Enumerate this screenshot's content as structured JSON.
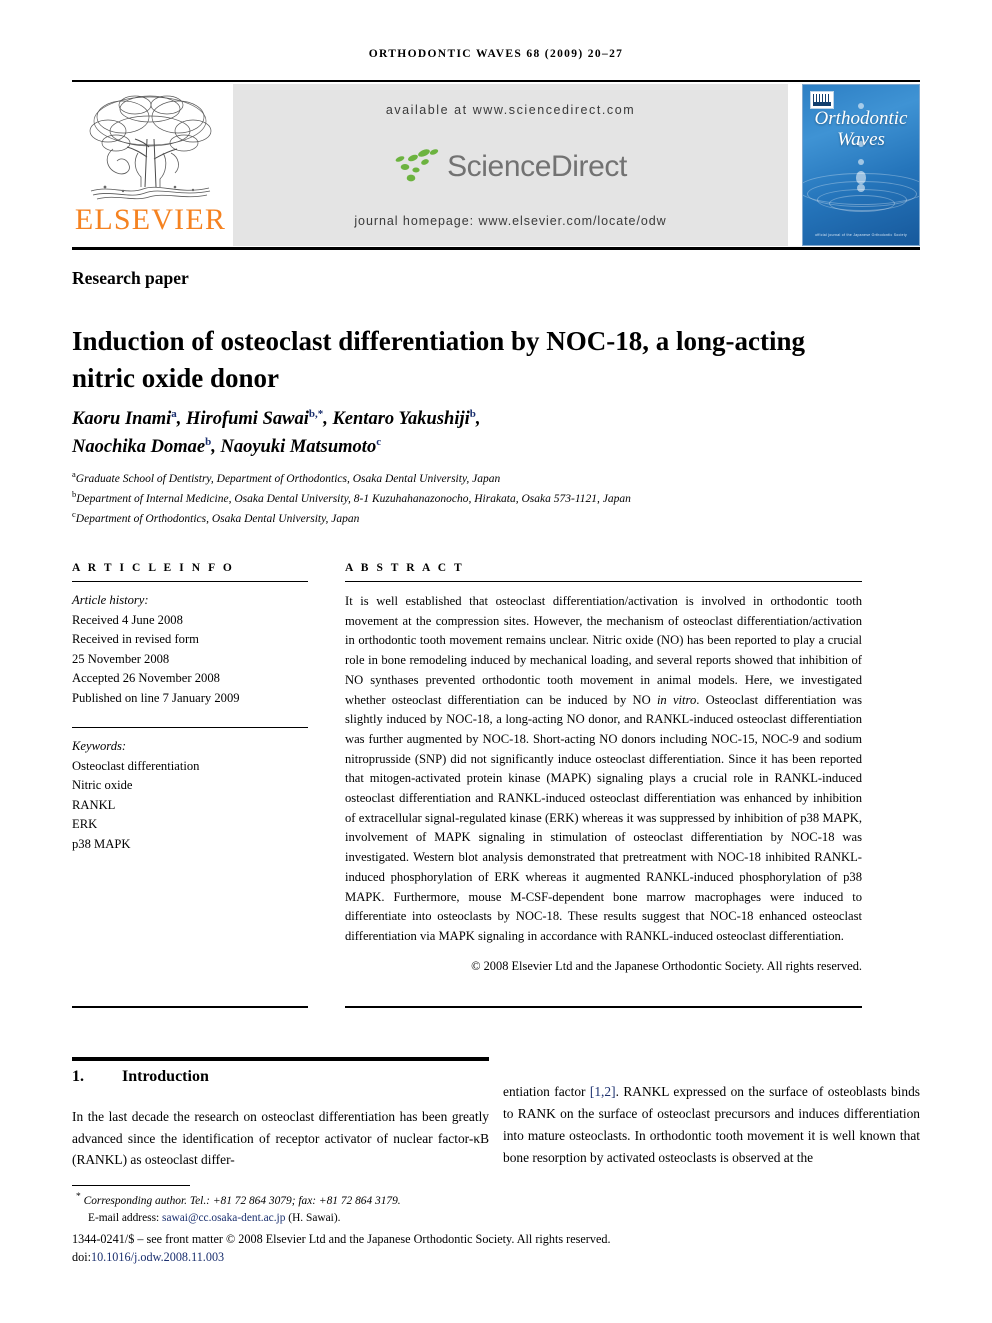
{
  "running_head": "ORTHODONTIC WAVES 68 (2009) 20–27",
  "masthead": {
    "publisher_wordmark": "ELSEVIER",
    "available_at": "available at www.sciencedirect.com",
    "sciencedirect_wordmark": "ScienceDirect",
    "journal_homepage": "journal homepage: www.elsevier.com/locate/odw",
    "cover": {
      "title_line1": "Orthodontic",
      "title_line2": "Waves",
      "footer": "official journal of the Japanese Orthodontic Society"
    },
    "colors": {
      "elsevier_orange": "#F58220",
      "sciencedirect_green": "#6CB33F",
      "sciencedirect_grey": "#727272",
      "band_grey": "#E4E4E4",
      "cover_blue": "#2D7FC4",
      "link_navy": "#1A2F6E"
    }
  },
  "article": {
    "section_type": "Research paper",
    "title": "Induction of osteoclast differentiation by NOC-18, a long-acting nitric oxide donor",
    "authors": [
      {
        "name": "Kaoru Inami",
        "marks": "a"
      },
      {
        "name": "Hirofumi Sawai",
        "marks": "b,*"
      },
      {
        "name": "Kentaro Yakushiji",
        "marks": "b"
      },
      {
        "name": "Naochika Domae",
        "marks": "b"
      },
      {
        "name": "Naoyuki Matsumoto",
        "marks": "c"
      }
    ],
    "affiliations": [
      {
        "mark": "a",
        "text": "Graduate School of Dentistry, Department of Orthodontics, Osaka Dental University, Japan"
      },
      {
        "mark": "b",
        "text": "Department of Internal Medicine, Osaka Dental University, 8-1 Kuzuhahanazonocho, Hirakata, Osaka 573-1121, Japan"
      },
      {
        "mark": "c",
        "text": "Department of Orthodontics, Osaka Dental University, Japan"
      }
    ]
  },
  "article_info": {
    "label": "A R T I C L E   I N F O",
    "history_heading": "Article history:",
    "history": [
      "Received 4 June 2008",
      "Received in revised form",
      "25 November 2008",
      "Accepted 26 November 2008",
      "Published on line 7 January 2009"
    ],
    "keywords_heading": "Keywords:",
    "keywords": [
      "Osteoclast differentiation",
      "Nitric oxide",
      "RANKL",
      "ERK",
      "p38 MAPK"
    ]
  },
  "abstract": {
    "label": "A B S T R A C T",
    "text_part1": "It is well established that osteoclast differentiation/activation is involved in orthodontic tooth movement at the compression sites. However, the mechanism of osteoclast differentiation/activation in orthodontic tooth movement remains unclear. Nitric oxide (NO) has been reported to play a crucial role in bone remodeling induced by mechanical loading, and several reports showed that inhibition of NO synthases prevented orthodontic tooth movement in animal models. Here, we investigated whether osteoclast differentiation can be induced by NO ",
    "italic1": "in vitro",
    "text_part2": ". Osteoclast differentiation was slightly induced by NOC-18, a long-acting NO donor, and RANKL-induced osteoclast differentiation was further augmented by NOC-18. Short-acting NO donors including NOC-15, NOC-9 and sodium nitroprusside (SNP) did not significantly induce osteoclast differentiation. Since it has been reported that mitogen-activated protein kinase (MAPK) signaling plays a crucial role in RANKL-induced osteoclast differentiation and RANKL-induced osteoclast differentiation was enhanced by inhibition of extracellular signal-regulated kinase (ERK) whereas it was suppressed by inhibition of p38 MAPK, involvement of MAPK signaling in stimulation of osteoclast differentiation by NOC-18 was investigated. Western blot analysis demonstrated that pretreatment with NOC-18 inhibited RANKL-induced phosphorylation of ERK whereas it augmented RANKL-induced phosphorylation of p38 MAPK. Furthermore, mouse M-CSF-dependent bone marrow macrophages were induced to differentiate into osteoclasts by NOC-18. These results suggest that NOC-18 enhanced osteoclast differentiation via MAPK signaling in accordance with RANKL-induced osteoclast differentiation.",
    "copyright": "© 2008 Elsevier Ltd and the Japanese Orthodontic Society. All rights reserved."
  },
  "body": {
    "section_number": "1.",
    "section_title": "Introduction",
    "left_paragraph": "In the last decade the research on osteoclast differentiation has been greatly advanced since the identification of receptor activator of nuclear factor-κB (RANKL) as osteoclast differ-",
    "right_paragraph_pre": "entiation factor ",
    "right_reference": "[1,2]",
    "right_paragraph_post": ". RANKL expressed on the surface of osteoblasts binds to RANK on the surface of osteoclast precursors and induces differentiation into mature osteoclasts. In orthodontic tooth movement it is well known that bone resorption by activated osteoclasts is observed at the"
  },
  "footer": {
    "corresponding_marker": "*",
    "corresponding": "Corresponding author. Tel.: +81 72 864 3079; fax: +81 72 864 3179.",
    "email_label": "E-mail address:",
    "email": "sawai@cc.osaka-dent.ac.jp",
    "email_owner": "(H. Sawai).",
    "front_matter": "1344-0241/$ – see front matter © 2008 Elsevier Ltd and the Japanese Orthodontic Society. All rights reserved.",
    "doi_label": "doi:",
    "doi": "10.1016/j.odw.2008.11.003"
  }
}
